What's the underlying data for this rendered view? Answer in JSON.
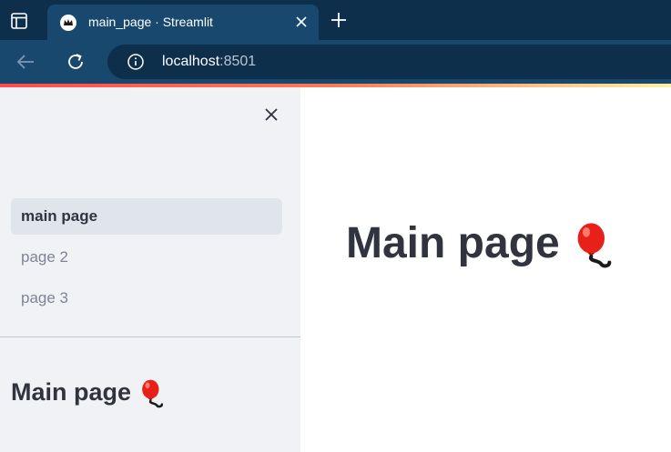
{
  "browser": {
    "tab_title": "main_page · Streamlit",
    "url_host": "localhost",
    "url_port": ":8501"
  },
  "sidebar": {
    "nav_items": [
      {
        "label": "main page",
        "active": true
      },
      {
        "label": "page 2",
        "active": false
      },
      {
        "label": "page 3",
        "active": false
      }
    ],
    "heading": "Main page"
  },
  "main": {
    "title": "Main page"
  },
  "icons": {
    "title_emoji": "balloon-icon"
  },
  "colors": {
    "accent": "#ff4b4b",
    "sidebar_bg": "#f0f2f6",
    "text": "#31333f"
  }
}
